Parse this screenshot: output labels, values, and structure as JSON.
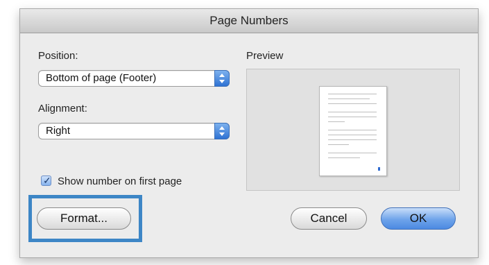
{
  "dialog": {
    "title": "Page Numbers"
  },
  "position": {
    "label": "Position:",
    "value": "Bottom of page (Footer)"
  },
  "alignment": {
    "label": "Alignment:",
    "value": "Right"
  },
  "preview": {
    "label": "Preview"
  },
  "show_first": {
    "label": "Show number on first page",
    "checked": true
  },
  "buttons": {
    "format": "Format...",
    "cancel": "Cancel",
    "ok": "OK"
  },
  "colors": {
    "highlight": "#3d86c6",
    "accent": "#2e72d3"
  }
}
